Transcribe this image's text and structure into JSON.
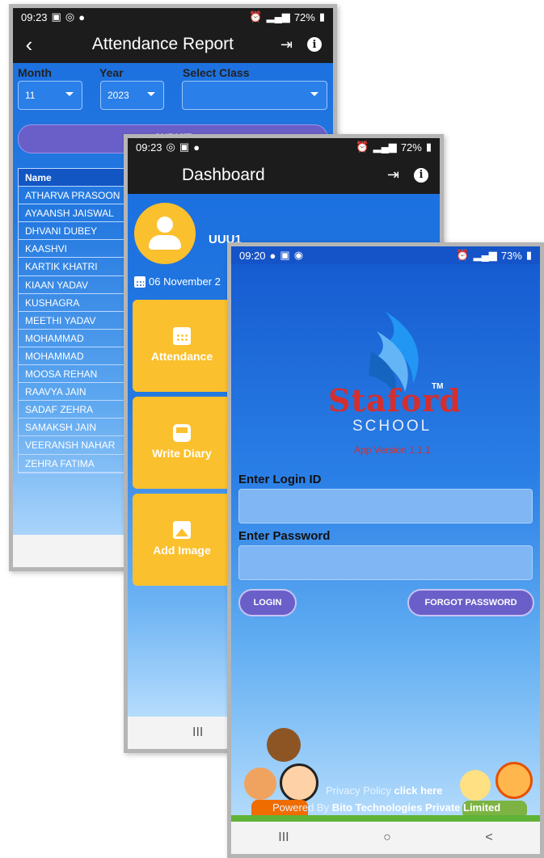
{
  "attendance": {
    "status_time": "09:23",
    "status_battery": "72%",
    "title": "Attendance Report",
    "month_label": "Month",
    "year_label": "Year",
    "class_label": "Select Class",
    "month_value": "11",
    "year_value": "2023",
    "class_value": "",
    "submit_label": "SUBMIT",
    "table_header": "Name",
    "names": [
      "ATHARVA PRASOON",
      "AYAANSH JAISWAL",
      "DHVANI DUBEY",
      "KAASHVI",
      "KARTIK KHATRI",
      "KIAAN YADAV",
      "KUSHAGRA",
      "MEETHI YADAV",
      "MOHAMMAD",
      "MOHAMMAD",
      "MOOSA REHAN",
      "RAAVYA JAIN",
      "SADAF ZEHRA",
      "SAMAKSH JAIN",
      "VEERANSH NAHAR",
      "ZEHRA FATIMA"
    ]
  },
  "dashboard": {
    "status_time": "09:23",
    "status_battery": "72%",
    "title": "Dashboard",
    "username": "UUU1",
    "date": "06 November 2",
    "tiles": [
      "Attendance",
      "Write Diary",
      "Add Image"
    ]
  },
  "login": {
    "status_time": "09:20",
    "status_battery": "73%",
    "brand": "Staford",
    "brand_tm": "TM",
    "brand_sub": "SCHOOL",
    "version": "App Version 1.1.1",
    "login_id_label": "Enter Login ID",
    "login_id_value": "",
    "password_label": "Enter Password",
    "password_value": "",
    "login_button": "LOGIN",
    "forgot_button": "FORGOT PASSWORD",
    "privacy_prefix": "Privacy Policy",
    "privacy_link": "click here",
    "powered_prefix": "Powered By",
    "powered_company": "Bito Technologies Private Limited"
  },
  "nav": {
    "recents": "III",
    "home": "○",
    "back": "<"
  },
  "colors": {
    "appbar": "#1c1c1c",
    "screen_blue": "#1a6ee0",
    "accent_purple": "#6a5fc9",
    "tile_yellow": "#fbc02d",
    "brand_red": "#d32f2f"
  }
}
